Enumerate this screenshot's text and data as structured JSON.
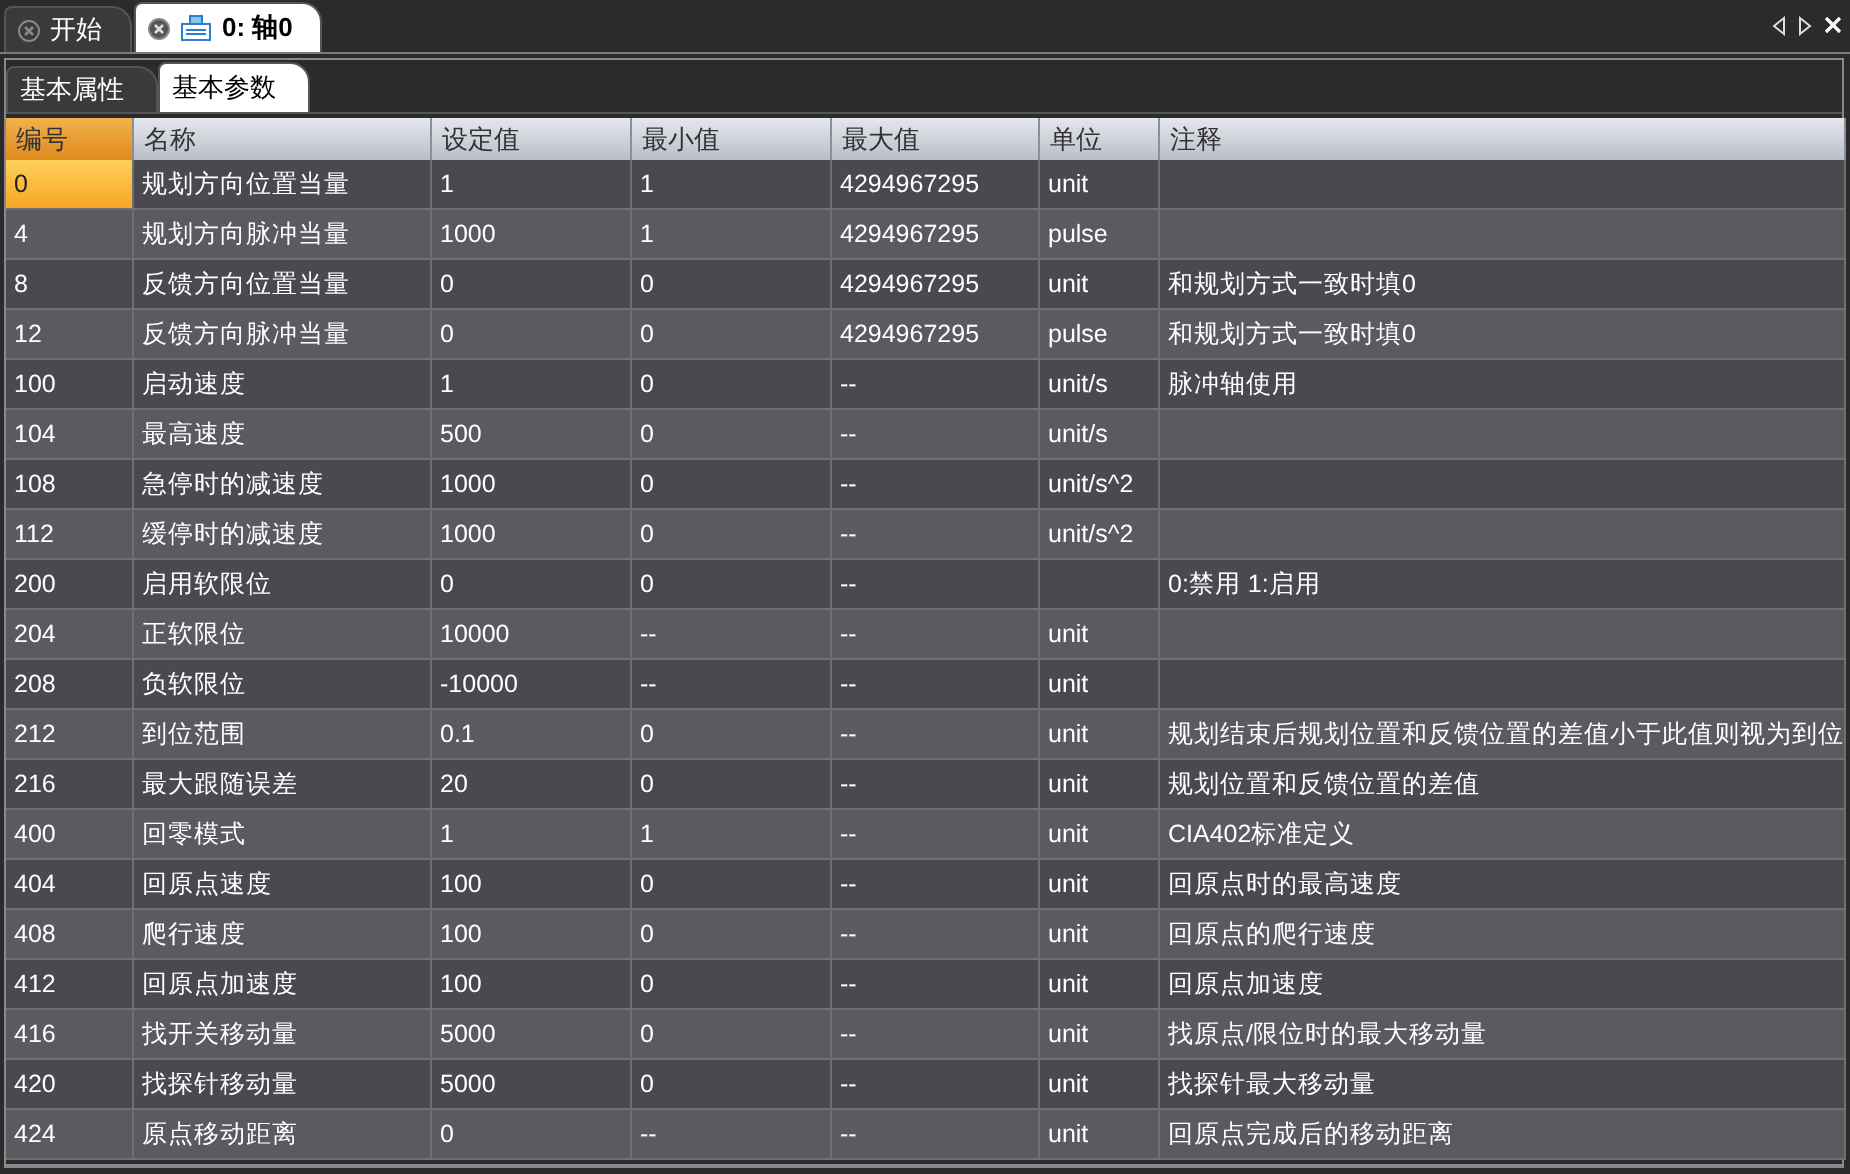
{
  "doc_tabs": [
    {
      "label": "开始",
      "selected": false
    },
    {
      "label": "0: 轴0",
      "selected": true
    }
  ],
  "sub_tabs": [
    {
      "label": "基本属性",
      "selected": false
    },
    {
      "label": "基本参数",
      "selected": true
    }
  ],
  "table": {
    "columns": [
      "编号",
      "名称",
      "设定值",
      "最小值",
      "最大值",
      "单位",
      "注释"
    ],
    "rows": [
      {
        "cells": [
          "0",
          "规划方向位置当量",
          "1",
          "1",
          "4294967295",
          "unit",
          ""
        ],
        "selected": true
      },
      {
        "cells": [
          "4",
          "规划方向脉冲当量",
          "1000",
          "1",
          "4294967295",
          "pulse",
          ""
        ],
        "selected": false
      },
      {
        "cells": [
          "8",
          "反馈方向位置当量",
          "0",
          "0",
          "4294967295",
          "unit",
          "和规划方式一致时填0"
        ],
        "selected": false
      },
      {
        "cells": [
          "12",
          "反馈方向脉冲当量",
          "0",
          "0",
          "4294967295",
          "pulse",
          "和规划方式一致时填0"
        ],
        "selected": false
      },
      {
        "cells": [
          "100",
          "启动速度",
          "1",
          "0",
          "--",
          "unit/s",
          "脉冲轴使用"
        ],
        "selected": false
      },
      {
        "cells": [
          "104",
          "最高速度",
          "500",
          "0",
          "--",
          "unit/s",
          ""
        ],
        "selected": false
      },
      {
        "cells": [
          "108",
          "急停时的减速度",
          "1000",
          "0",
          "--",
          "unit/s^2",
          ""
        ],
        "selected": false
      },
      {
        "cells": [
          "112",
          "缓停时的减速度",
          "1000",
          "0",
          "--",
          "unit/s^2",
          ""
        ],
        "selected": false
      },
      {
        "cells": [
          "200",
          "启用软限位",
          "0",
          "0",
          "--",
          "",
          "0:禁用 1:启用"
        ],
        "selected": false
      },
      {
        "cells": [
          "204",
          "正软限位",
          "10000",
          "--",
          "--",
          "unit",
          ""
        ],
        "selected": false
      },
      {
        "cells": [
          "208",
          "负软限位",
          "-10000",
          "--",
          "--",
          "unit",
          ""
        ],
        "selected": false
      },
      {
        "cells": [
          "212",
          "到位范围",
          "0.1",
          "0",
          "--",
          "unit",
          "规划结束后规划位置和反馈位置的差值小于此值则视为到位"
        ],
        "selected": false
      },
      {
        "cells": [
          "216",
          "最大跟随误差",
          "20",
          "0",
          "--",
          "unit",
          "规划位置和反馈位置的差值"
        ],
        "selected": false
      },
      {
        "cells": [
          "400",
          "回零模式",
          "1",
          "1",
          "--",
          "unit",
          "CIA402标准定义"
        ],
        "selected": false
      },
      {
        "cells": [
          "404",
          "回原点速度",
          "100",
          "0",
          "--",
          "unit",
          "回原点时的最高速度"
        ],
        "selected": false
      },
      {
        "cells": [
          "408",
          "爬行速度",
          "100",
          "0",
          "--",
          "unit",
          "回原点的爬行速度"
        ],
        "selected": false
      },
      {
        "cells": [
          "412",
          "回原点加速度",
          "100",
          "0",
          "--",
          "unit",
          "回原点加速度"
        ],
        "selected": false
      },
      {
        "cells": [
          "416",
          "找开关移动量",
          "5000",
          "0",
          "--",
          "unit",
          "找原点/限位时的最大移动量"
        ],
        "selected": false
      },
      {
        "cells": [
          "420",
          "找探针移动量",
          "5000",
          "0",
          "--",
          "unit",
          "找探针最大移动量"
        ],
        "selected": false
      },
      {
        "cells": [
          "424",
          "原点移动距离",
          "0",
          "--",
          "--",
          "unit",
          "回原点完成后的移动距离"
        ],
        "selected": false
      }
    ]
  }
}
